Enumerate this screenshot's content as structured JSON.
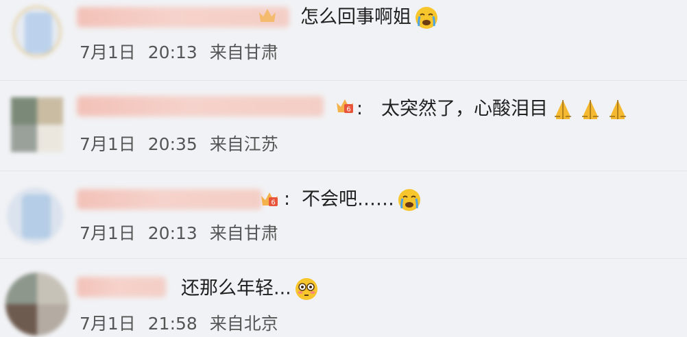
{
  "comments": [
    {
      "text": "怎么回事啊姐",
      "emoji": [
        "crying-face"
      ],
      "date": "7月1日",
      "time": "20:13",
      "location": "来自甘肃"
    },
    {
      "text": "太突然了，心酸泪目",
      "emoji": [
        "folded-hands",
        "folded-hands",
        "folded-hands"
      ],
      "date": "7月1日",
      "time": "20:35",
      "location": "来自江苏"
    },
    {
      "text": "不会吧……",
      "emoji": [
        "crying-face"
      ],
      "date": "7月1日",
      "time": "20:13",
      "location": "来自甘肃"
    },
    {
      "text": "还那么年轻...",
      "emoji": [
        "flushed-face"
      ],
      "date": "7月1日",
      "time": "21:58",
      "location": "来自北京"
    }
  ],
  "colors": {
    "background": "#f1f2f5",
    "username_redacted": "#f3b9ad",
    "meta_text": "#555555",
    "comment_text": "#1f1f1f"
  }
}
